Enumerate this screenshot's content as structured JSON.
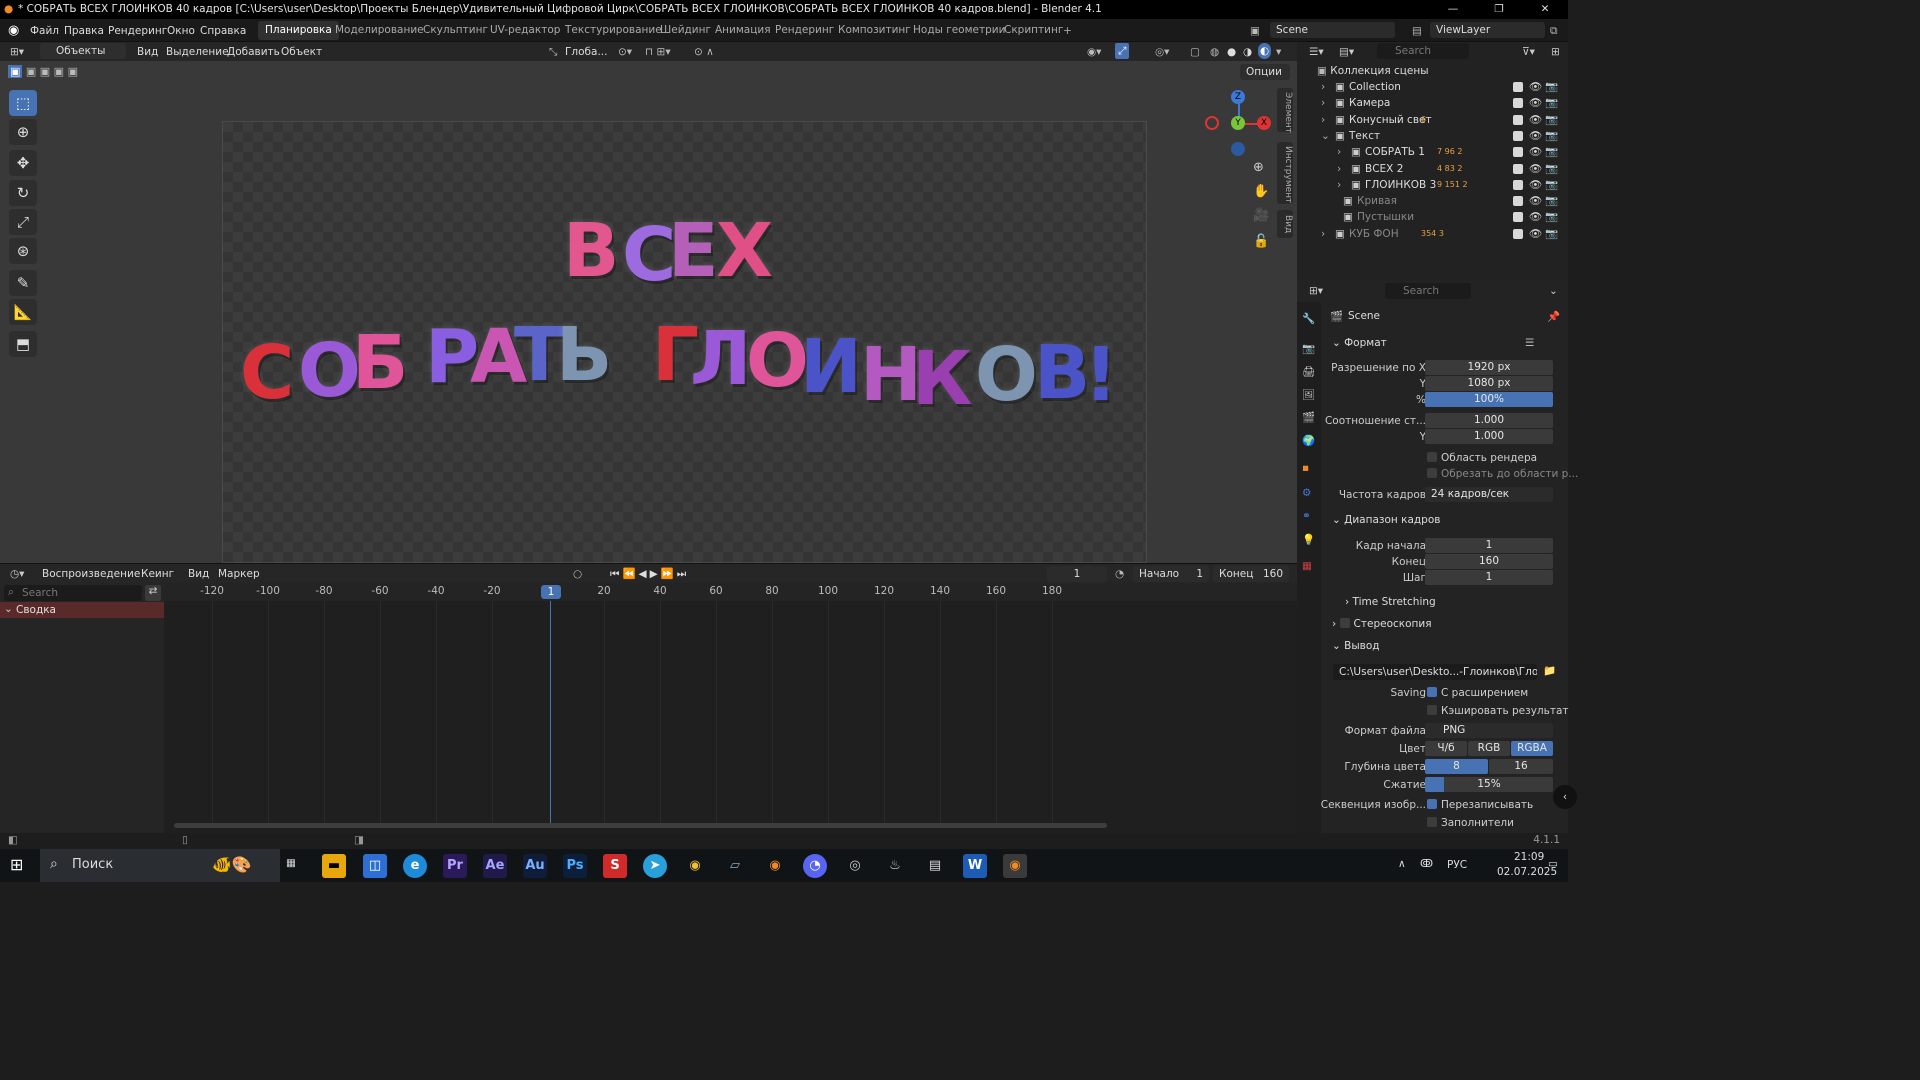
{
  "window": {
    "title": "* СОБРАТЬ ВСЕХ ГЛОИНКОВ 40 кадров [C:\\Users\\user\\Desktop\\Проекты Блендер\\Удивительный Цифровой Цирк\\СОБРАТЬ ВСЕХ ГЛОИНКОВ\\СОБРАТЬ ВСЕХ ГЛОИНКОВ 40 кадров.blend] - Blender 4.1",
    "minimize": "—",
    "maximize": "❐",
    "close": "✕"
  },
  "menu": {
    "file": "Файл",
    "edit": "Правка",
    "render": "Рендеринг",
    "window": "Окно",
    "help": "Справка"
  },
  "workspaces": [
    "Планировка",
    "Моделирование",
    "Скульптинг",
    "UV-редактор",
    "Текстурирование",
    "Шейдинг",
    "Анимация",
    "Рендеринг",
    "Композитинг",
    "Ноды геометрии",
    "Скриптинг"
  ],
  "scene": {
    "name": "Scene",
    "viewlayer": "ViewLayer"
  },
  "viewport_header": {
    "mode": "Объекты",
    "view": "Вид",
    "select": "Выделение",
    "add": "Добавить",
    "object": "Объект",
    "orientation": "Глоба...",
    "options": "Опции"
  },
  "side_tabs": [
    "Элемент",
    "Инструмент",
    "Вид"
  ],
  "text_object": {
    "line1": [
      "В",
      "С",
      "Е",
      "Х"
    ],
    "line2": [
      "С",
      "О",
      "Б",
      "Р",
      "А",
      "Т",
      "Ь",
      "Г",
      "Л",
      "О",
      "И",
      "Н",
      "К",
      "О",
      "В",
      "!"
    ],
    "colors": {
      "red": "#d9303a",
      "pink": "#e0549a",
      "purple": "#9a5ad8",
      "blue": "#4a54c8",
      "gray": "#7d95b0"
    }
  },
  "gizmo": {
    "z": "Z",
    "y": "Y",
    "x": "X"
  },
  "timeline": {
    "playback": "Воспроизведение",
    "keying": "Кеинг",
    "view": "Вид",
    "marker": "Маркер",
    "current": "1",
    "start_label": "Начало",
    "start": "1",
    "end_label": "Конец",
    "end": "160",
    "search": "Search",
    "summary": "Сводка",
    "ticks": [
      "-120",
      "-100",
      "-80",
      "-60",
      "-40",
      "-20",
      "1",
      "20",
      "40",
      "60",
      "80",
      "100",
      "120",
      "140",
      "160",
      "180"
    ]
  },
  "outliner": {
    "search": "Search",
    "root": "Коллекция сцены",
    "items": [
      {
        "label": "Collection",
        "badge": ""
      },
      {
        "label": "Камера",
        "badge": ""
      },
      {
        "label": "Конусный свет",
        "badge": "6"
      },
      {
        "label": "Текст",
        "badge": ""
      },
      {
        "label": "СОБРАТЬ 1",
        "badge": "7 96 2"
      },
      {
        "label": "ВСЕХ 2",
        "badge": "4 83 2"
      },
      {
        "label": "ГЛОИНКОВ 3",
        "badge": "9 151 2"
      },
      {
        "label": "Кривая",
        "badge": ""
      },
      {
        "label": "Пустышки",
        "badge": ""
      },
      {
        "label": "КУБ ФОН",
        "badge": "354 3"
      }
    ]
  },
  "properties": {
    "search": "Search",
    "context": "Scene",
    "format": {
      "title": "Формат",
      "res_x_label": "Разрешение по X",
      "res_x": "1920 px",
      "res_y_label": "Y",
      "res_y": "1080 px",
      "pct_label": "%",
      "pct": "100%",
      "aspect_label": "Соотношение ст...",
      "aspect_x": "1.000",
      "aspect_y_label": "Y",
      "aspect_y": "1.000",
      "render_region": "Область рендера",
      "crop": "Обрезать до области р...",
      "fps_label": "Частота кадров",
      "fps": "24 кадров/сек"
    },
    "frame_range": {
      "title": "Диапазон кадров",
      "start_label": "Кадр начала",
      "start": "1",
      "end_label": "Конец",
      "end": "160",
      "step_label": "Шаг",
      "step": "1"
    },
    "time_stretching": "Time Stretching",
    "stereo": "Стереоскопия",
    "output": {
      "title": "Вывод",
      "path": "C:\\Users\\user\\Deskto...-Глоинков\\Глоинков\\",
      "saving_label": "Saving",
      "ext": "С расширением",
      "cache": "Кэшировать результат",
      "format_label": "Формат файла",
      "format": "PNG",
      "color_label": "Цвет",
      "color_bw": "Ч/б",
      "color_rgb": "RGB",
      "color_rgba": "RGBA",
      "depth_label": "Глубина цвета",
      "depth_8": "8",
      "depth_16": "16",
      "compress_label": "Сжатие",
      "compress": "15%",
      "seq_label": "Секвенция изобр...",
      "overwrite": "Перезаписывать",
      "placeholders": "Заполнители"
    }
  },
  "status": {
    "version": "4.1.1"
  },
  "taskbar": {
    "search": "Поиск",
    "lang": "РУС",
    "time": "21:09",
    "date": "02.07.2025"
  }
}
